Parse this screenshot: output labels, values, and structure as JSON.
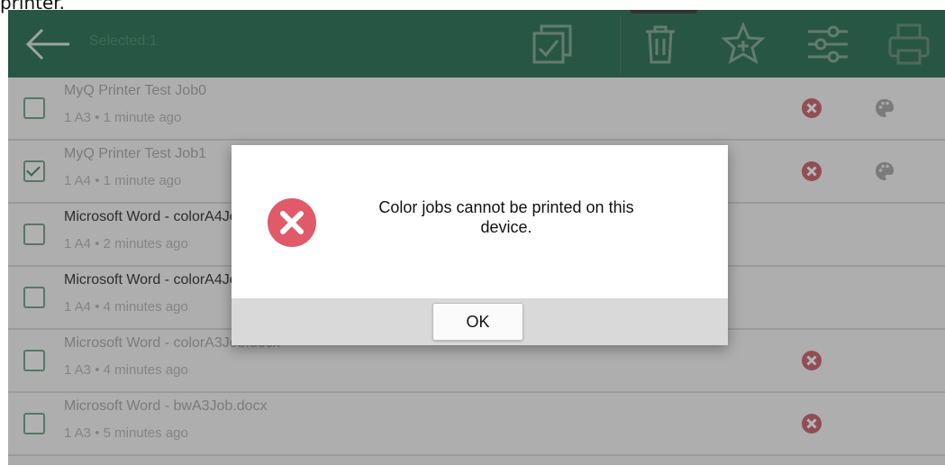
{
  "caption": "printer.",
  "toolbar": {
    "selected_label": "Selected:1",
    "back_icon": "arrow-left-icon",
    "select_all_icon": "checkbox-stack-icon",
    "delete_icon": "trash-icon",
    "favorite_icon": "star-plus-icon",
    "settings_icon": "sliders-icon",
    "print_icon": "printer-icon"
  },
  "jobs": [
    {
      "title": "MyQ Printer Test Job0",
      "meta": "1 A3 • 1 minute ago",
      "checked": false,
      "error": true,
      "color": true
    },
    {
      "title": "MyQ Printer Test Job1",
      "meta": "1 A4 • 1 minute ago",
      "checked": true,
      "error": true,
      "color": true
    },
    {
      "title": "Microsoft Word - colorA4Job.docx",
      "meta": "1 A4 • 2 minutes ago",
      "checked": false,
      "error": false,
      "color": false
    },
    {
      "title": "Microsoft Word - colorA4Job.docx",
      "meta": "1 A4 • 4 minutes ago",
      "checked": false,
      "error": false,
      "color": false
    },
    {
      "title": "Microsoft Word - colorA3Job.docx",
      "meta": "1 A3 • 4 minutes ago",
      "checked": false,
      "error": true,
      "color": false
    },
    {
      "title": "Microsoft Word - bwA3Job.docx",
      "meta": "1 A3 • 5 minutes ago",
      "checked": false,
      "error": true,
      "color": false
    }
  ],
  "dialog": {
    "message": "Color jobs cannot be printed on this device.",
    "ok_label": "OK",
    "icon": "error-x-icon"
  },
  "colors": {
    "toolbar_bg": "#0b5a3d",
    "error_red": "#e05a6a"
  }
}
